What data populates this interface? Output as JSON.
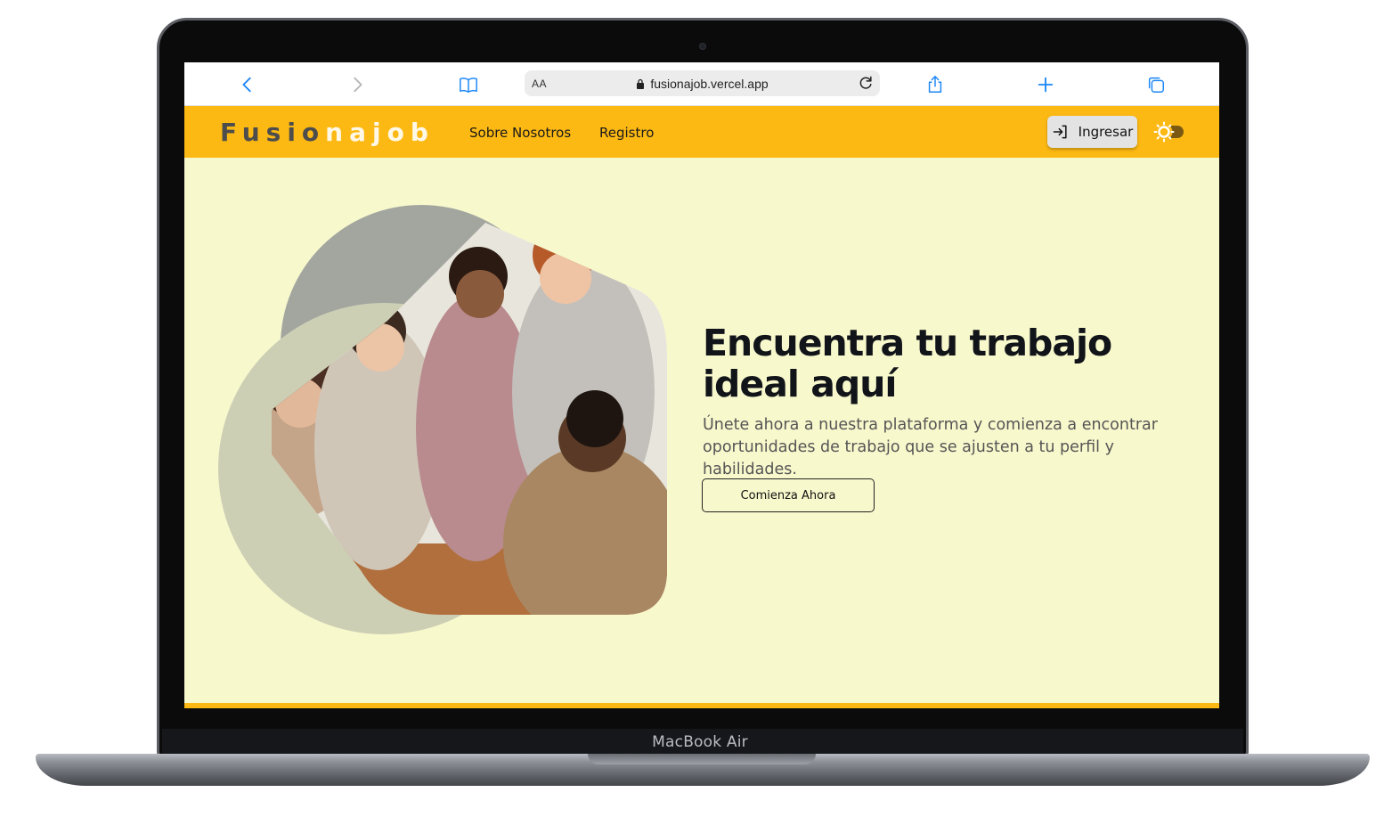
{
  "device": {
    "label": "MacBook Air"
  },
  "browser": {
    "url_display": "fusionajob.vercel.app",
    "reader_label": "AA",
    "icons": [
      "back-icon",
      "forward-icon",
      "bookmarks-icon",
      "lock-icon",
      "reload-icon",
      "share-icon",
      "new-tab-icon",
      "tabs-icon"
    ]
  },
  "site": {
    "logo_part1": "Fusio",
    "logo_part2": "najob",
    "nav": {
      "about": "Sobre Nosotros",
      "register": "Registro"
    },
    "login_label": "Ingresar",
    "theme_toggle_icon": "sun-icon"
  },
  "hero": {
    "title": "Encuentra tu trabajo ideal aquí",
    "subtitle": "Únete ahora a nuestra plataforma y comienza a encontrar oportunidades de trabajo que se ajusten a tu perfil y habilidades.",
    "cta": "Comienza Ahora"
  },
  "colors": {
    "brand_yellow": "#fdb913",
    "hero_bg": "#f8f8cd",
    "safari_accent": "#1b86f6"
  }
}
